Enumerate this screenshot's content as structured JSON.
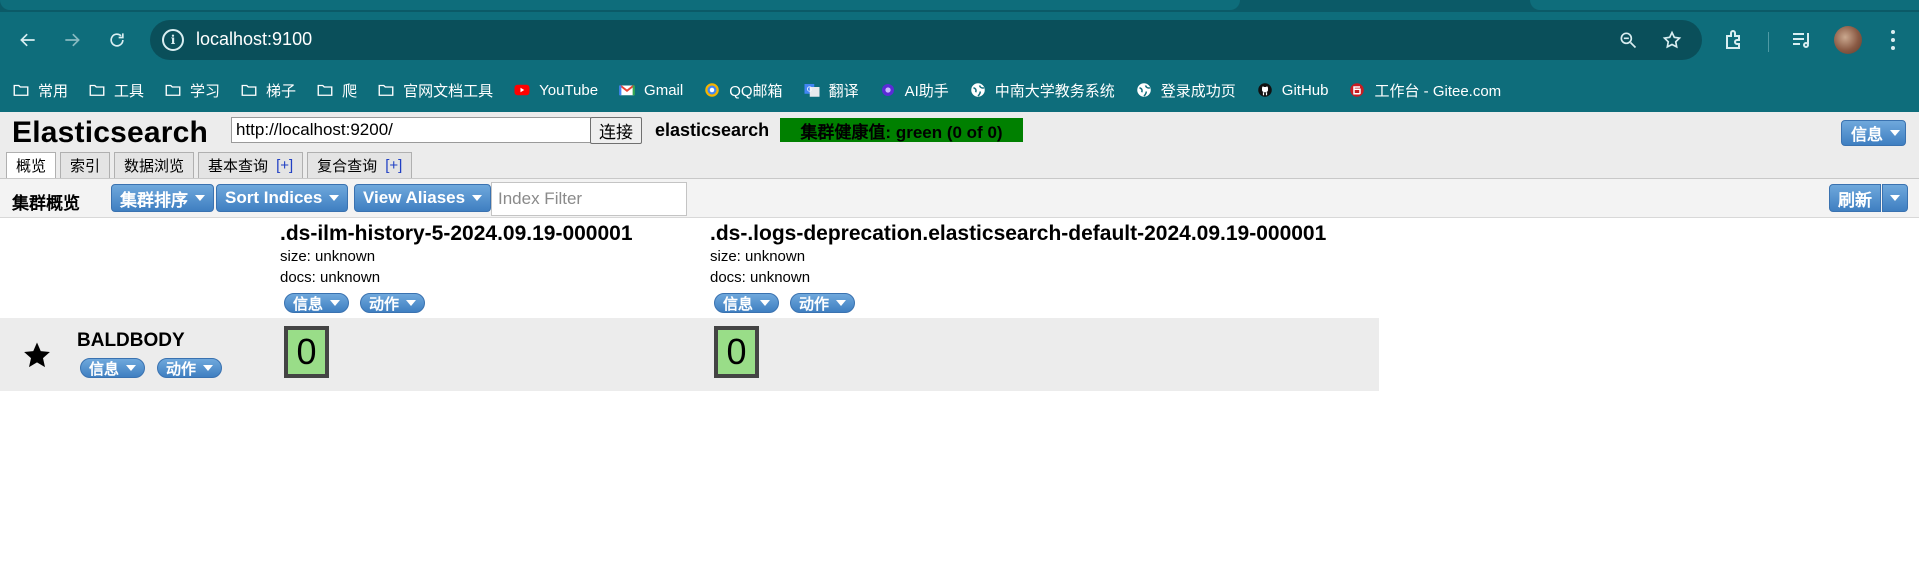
{
  "browser": {
    "url": "localhost:9100",
    "bookmarks": [
      {
        "label": "常用",
        "icon": "folder-icon"
      },
      {
        "label": "工具",
        "icon": "folder-icon"
      },
      {
        "label": "学习",
        "icon": "folder-icon"
      },
      {
        "label": "梯子",
        "icon": "folder-icon"
      },
      {
        "label": "爬",
        "icon": "folder-icon"
      },
      {
        "label": "官网文档工具",
        "icon": "folder-icon"
      },
      {
        "label": "YouTube",
        "icon": "youtube-icon"
      },
      {
        "label": "Gmail",
        "icon": "gmail-icon"
      },
      {
        "label": "QQ邮箱",
        "icon": "qqmail-icon"
      },
      {
        "label": "翻译",
        "icon": "translate-icon"
      },
      {
        "label": "AI助手",
        "icon": "ai-assistant-icon"
      },
      {
        "label": "中南大学教务系统",
        "icon": "globe-icon"
      },
      {
        "label": "登录成功页",
        "icon": "globe-icon"
      },
      {
        "label": "GitHub",
        "icon": "github-icon"
      },
      {
        "label": "工作台 - Gitee.com",
        "icon": "gitee-icon"
      }
    ]
  },
  "app": {
    "title": "Elasticsearch",
    "connect_url": "http://localhost:9200/",
    "connect_label": "连接",
    "cluster_name": "elasticsearch",
    "health_text": "集群健康值: green (0 of 0)",
    "info_label": "信息",
    "tabs": [
      {
        "label": "概览",
        "plus": ""
      },
      {
        "label": "索引",
        "plus": ""
      },
      {
        "label": "数据浏览",
        "plus": ""
      },
      {
        "label": "基本查询",
        "plus": "[+]"
      },
      {
        "label": "复合查询",
        "plus": "[+]"
      }
    ],
    "overview": {
      "title": "集群概览",
      "sort_cluster": "集群排序",
      "sort_indices": "Sort Indices",
      "view_aliases": "View Aliases",
      "filter_placeholder": "Index Filter",
      "refresh": "刷新"
    },
    "indices": [
      {
        "name": ".ds-ilm-history-5-2024.09.19-000001",
        "size": "size: unknown",
        "docs": "docs: unknown",
        "info": "信息",
        "action": "动作"
      },
      {
        "name": ".ds-.logs-deprecation.elasticsearch-default-2024.09.19-000001",
        "size": "size: unknown",
        "docs": "docs: unknown",
        "info": "信息",
        "action": "动作"
      }
    ],
    "node": {
      "name": "BALDBODY",
      "info": "信息",
      "action": "动作",
      "shards": [
        "0",
        "0"
      ]
    }
  },
  "colors": {
    "chrome": "#0e6d7b",
    "health_green": "#008000",
    "shard_green": "#99dd88",
    "button_blue": "#3f7fc1"
  }
}
